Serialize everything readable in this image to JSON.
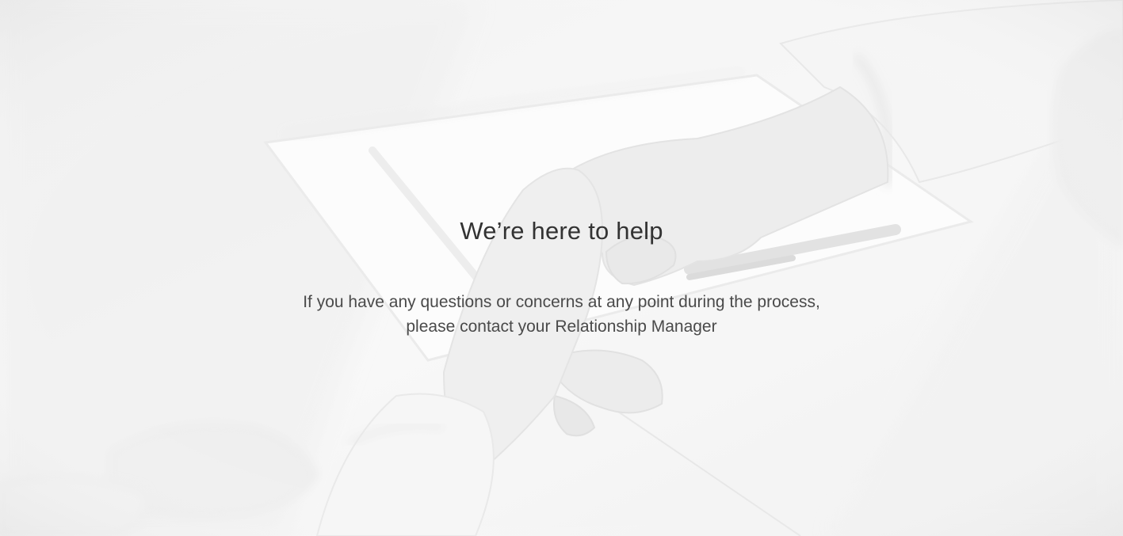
{
  "banner": {
    "background_image": "handshake-photo",
    "title": "We’re here to help",
    "lines": [
      "If you have any questions or concerns at any point during the process,",
      "please contact your Relationship Manager"
    ]
  },
  "colors": {
    "title": "#333333",
    "body": "#4a4a4a",
    "background": "#f3f3f3"
  }
}
